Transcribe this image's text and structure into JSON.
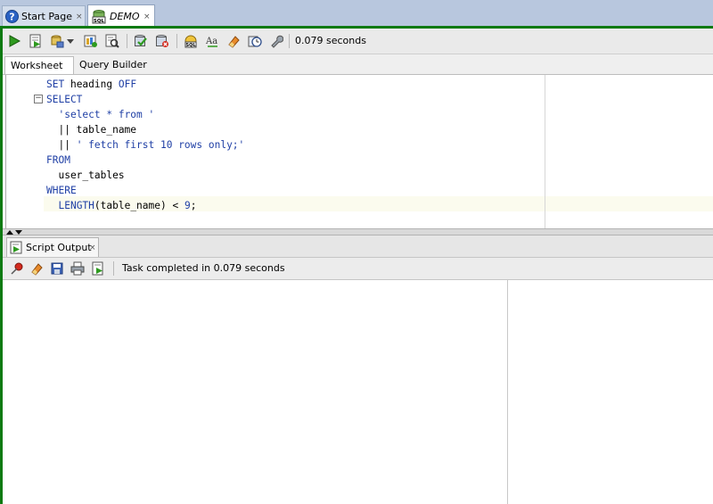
{
  "document_tabs": [
    {
      "label": "Start Page",
      "icon": "help-icon",
      "close": "×"
    },
    {
      "label": "DEMO",
      "icon": "sql-worksheet-icon",
      "close": "×"
    }
  ],
  "toolbar": {
    "buttons": [
      "run-statement-icon",
      "run-script-icon",
      "commit-icon",
      "dropdown-arrow-icon",
      "autotrace-icon",
      "explain-plan-icon",
      "commit-check-icon",
      "rollback-icon",
      "sql-tuning-icon",
      "change-case-icon",
      "clear-eraser-icon",
      "history-clock-icon",
      "wrench-icon"
    ],
    "elapsed": "0.079 seconds"
  },
  "sub_tabs": {
    "worksheet": "Worksheet",
    "query_builder": "Query Builder"
  },
  "editor": {
    "lines": [
      [
        {
          "t": "SET",
          "c": "kw"
        },
        {
          "t": " heading ",
          "c": ""
        },
        {
          "t": "OFF",
          "c": "kw"
        }
      ],
      [
        {
          "t": "SELECT",
          "c": "kw"
        }
      ],
      [
        {
          "t": "  ",
          "c": ""
        },
        {
          "t": "'select * from '",
          "c": "str"
        }
      ],
      [
        {
          "t": "  || table_name",
          "c": ""
        }
      ],
      [
        {
          "t": "  || ",
          "c": ""
        },
        {
          "t": "' fetch first 10 rows only;'",
          "c": "str"
        }
      ],
      [
        {
          "t": "FROM",
          "c": "kw"
        }
      ],
      [
        {
          "t": "  user_tables",
          "c": ""
        }
      ],
      [
        {
          "t": "WHERE",
          "c": "kw"
        }
      ],
      [
        {
          "t": "  ",
          "c": ""
        },
        {
          "t": "LENGTH",
          "c": "kw"
        },
        {
          "t": "(table_name) < ",
          "c": ""
        },
        {
          "t": "9",
          "c": "num"
        },
        {
          "t": ";",
          "c": ""
        }
      ]
    ]
  },
  "output": {
    "tab_label": "Script Output",
    "close": "×",
    "status": "Task completed in 0.079 seconds",
    "toolbar_buttons": [
      "pin-icon",
      "clear-eraser-icon",
      "save-icon",
      "print-icon",
      "run-script-icon"
    ]
  },
  "colors": {
    "keyword": "#1f3fa5",
    "active_frame": "#0d7a12",
    "tabbar": "#b8c7de"
  }
}
